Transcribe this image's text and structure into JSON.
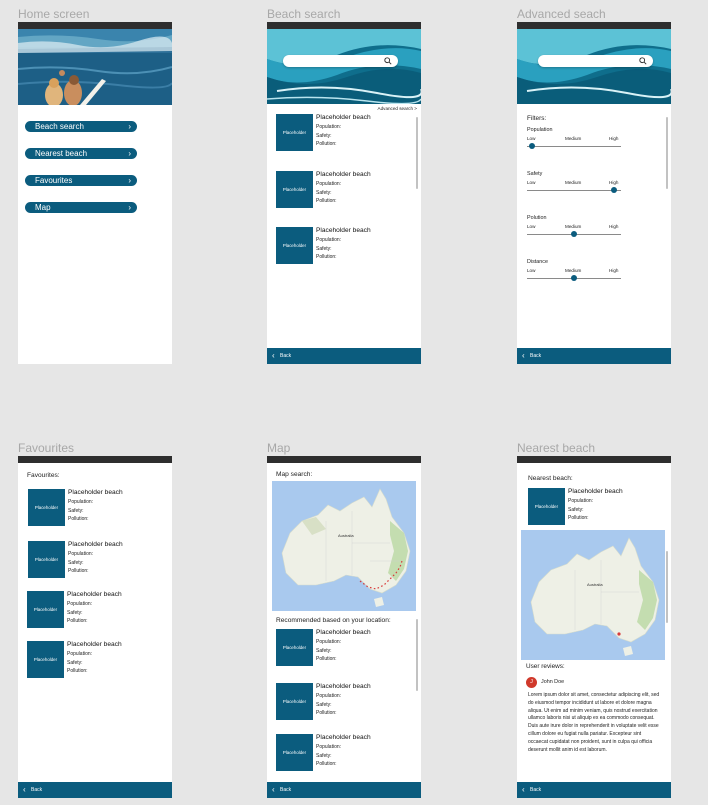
{
  "screens": {
    "home": {
      "title": "Home screen",
      "menu": [
        "Beach search",
        "Nearest beach",
        "Favourites",
        "Map"
      ]
    },
    "beach_search": {
      "title": "Beach search",
      "advanced_link": "Advanced search >",
      "back": "Back"
    },
    "advanced": {
      "title": "Advanced seach",
      "filters_label": "Filters:",
      "filters": [
        {
          "name": "Population",
          "low": "Low",
          "medium": "Medium",
          "high": "High",
          "level": 0.05
        },
        {
          "name": "Safety",
          "low": "Low",
          "medium": "Medium",
          "high": "High",
          "level": 0.93
        },
        {
          "name": "Polution",
          "low": "Low",
          "medium": "Medium",
          "high": "High",
          "level": 0.5
        },
        {
          "name": "Distance",
          "low": "Low",
          "medium": "Medium",
          "high": "High",
          "level": 0.5
        }
      ],
      "back": "Back"
    },
    "favourites": {
      "title": "Favourites",
      "heading": "Favourites:",
      "back": "Back"
    },
    "map": {
      "title": "Map",
      "heading": "Map search:",
      "recommended": "Recommended based on your location:",
      "map_label": "Australia",
      "back": "Back"
    },
    "nearest": {
      "title": "Nearest beach",
      "heading": "Nearest beach:",
      "reviews_label": "User reviews:",
      "reviewer": "John Doe",
      "avatar_initial": "J",
      "review": "Lorem ipsum dolor sit amet, consectetur adipiscing elit, sed do eiusmod tempor incididunt ut labore et dolore magna aliqua. Ut enim ad minim veniam, quis nostrud exercitation ullamco laboris nisi ut aliquip ex ea commodo consequat. Duis aute irure dolor in reprehenderit in voluptate velit esse cillum dolore eu fugiat nulla pariatur. Excepteur sint occaecat cupidatat non proident, sunt in culpa qui officia deserunt mollit anim id est laborum.",
      "map_label": "Australia",
      "back": "Back"
    }
  },
  "card": {
    "thumb": "Placeholder",
    "title": "Placeholder beach",
    "population": "Population:",
    "safety": "Safety:",
    "pollution": "Pollution:"
  },
  "colors": {
    "primary": "#0b5c7e",
    "status_bar": "#2e2e2e",
    "background": "#e6e6e6",
    "avatar": "#d0392b"
  },
  "icons": {
    "search": "magnifier-icon",
    "back": "chevron-left-icon",
    "menu_arrow": "chevron-right-icon"
  }
}
